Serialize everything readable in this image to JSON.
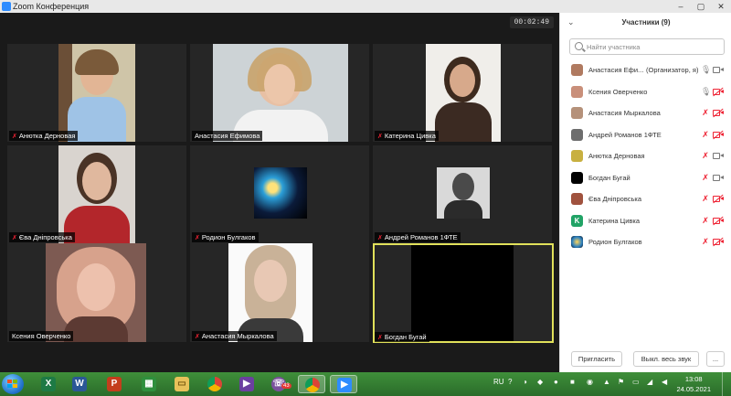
{
  "window": {
    "title": "Zoom Конференция"
  },
  "meeting": {
    "timer": "00:02:49",
    "tiles": [
      {
        "name": "Анютка Дерновая",
        "muted": true
      },
      {
        "name": "Анастасия Ефимова",
        "muted": false
      },
      {
        "name": "Катерина Цивка",
        "muted": true
      },
      {
        "name": "Єва Дніпровська",
        "muted": true
      },
      {
        "name": "Родион Булгаков",
        "muted": true
      },
      {
        "name": "Андрей Романов 1ФТЕ",
        "muted": true
      },
      {
        "name": "Ксения Оверченко",
        "muted": false
      },
      {
        "name": "Анастасия Мыркалова",
        "muted": true
      },
      {
        "name": "Богдан Бугай",
        "muted": true,
        "active_speaker": true
      }
    ]
  },
  "panel": {
    "title": "Участники (9)",
    "search_placeholder": "Найти участника",
    "participants": [
      {
        "name": "Анастасия Ефи...",
        "role": "(Организатор, я)",
        "mic": "on",
        "cam": "on",
        "avatar": "photo"
      },
      {
        "name": "Ксения Оверченко",
        "role": "",
        "mic": "on",
        "cam": "off",
        "avatar": "photo"
      },
      {
        "name": "Анастасия Мыркалова",
        "role": "",
        "mic": "off",
        "cam": "off",
        "avatar": "photo"
      },
      {
        "name": "Андрей Романов 1ФТЕ",
        "role": "",
        "mic": "off",
        "cam": "off",
        "avatar": "photo"
      },
      {
        "name": "Анютка Дерновая",
        "role": "",
        "mic": "off",
        "cam": "on",
        "avatar": "photo"
      },
      {
        "name": "Богдан Бугай",
        "role": "",
        "mic": "off",
        "cam": "on",
        "avatar": "black"
      },
      {
        "name": "Єва Дніпровська",
        "role": "",
        "mic": "off",
        "cam": "off",
        "avatar": "photo"
      },
      {
        "name": "Катерина Цивка",
        "role": "",
        "mic": "off",
        "cam": "off",
        "avatar": "letter",
        "letter": "K"
      },
      {
        "name": "Родион Булгаков",
        "role": "",
        "mic": "off",
        "cam": "off",
        "avatar": "photo"
      }
    ],
    "invite_label": "Пригласить",
    "mute_all_label": "Выкл. весь звук",
    "more_label": "..."
  },
  "taskbar": {
    "apps": [
      "excel",
      "word",
      "powerpoint-red",
      "excel-green",
      "file-explorer",
      "chrome",
      "media-player",
      "viber",
      "chrome-2",
      "zoom"
    ],
    "viber_badge": "43",
    "language": "RU",
    "time": "13:08",
    "date": "24.05.2021"
  },
  "colors": {
    "accent": "#2d8cff",
    "muted_red": "#e23333",
    "active_speaker": "#e0e05a",
    "taskbar": "#3a8a36"
  }
}
